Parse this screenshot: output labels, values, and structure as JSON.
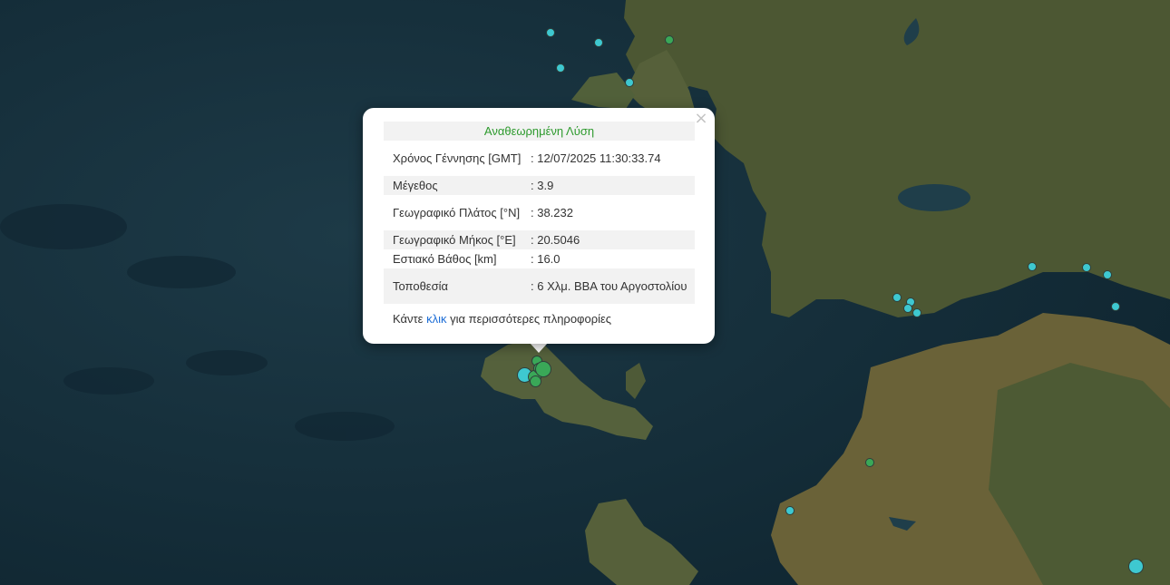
{
  "map": {
    "colors": {
      "sea": "#15303c",
      "land": "#4f5a34",
      "recent_marker": "#3aa858",
      "older_marker": "#3ec8d0"
    },
    "markers_note_legend": "",
    "popup": {
      "header": "Αναθεωρημένη Λύση",
      "rows": [
        {
          "label": "Χρόνος Γέννησης [GMT]",
          "value": ": 12/07/2025 11:30:33.74"
        },
        {
          "label": "Μέγεθος",
          "value": ": 3.9"
        },
        {
          "label": "Γεωγραφικό Πλάτος [°N]",
          "value": ": 38.232"
        },
        {
          "label": "Γεωγραφικό Μήκος [°E]",
          "value": ": 20.5046"
        },
        {
          "label": "Εστιακό Βάθος [km]",
          "value": ": 16.0"
        },
        {
          "label": "Τοποθεσία",
          "value": ": 6 Χλμ. ΒΒΑ του Αργοστολίου"
        }
      ],
      "more_prefix": "Κάντε ",
      "more_link": "κλικ",
      "more_suffix": " για περισσότερες πληροφορίες",
      "close_symbol": "×"
    }
  }
}
